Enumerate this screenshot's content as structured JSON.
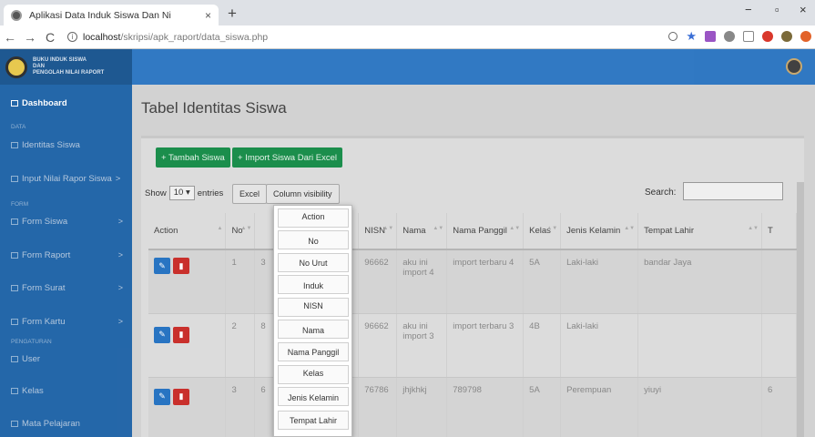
{
  "browser": {
    "tab_title": "Aplikasi Data Induk Siswa Dan Ni",
    "tab_close": "×",
    "new_tab": "+",
    "url_host": "localhost",
    "url_path": "/skripsi/apk_raport/data_siswa.php",
    "back": "←",
    "forward": "→",
    "reload": "C",
    "minimize": "−",
    "maximize": "▫",
    "close": "×"
  },
  "sidebar": {
    "brand": [
      "BUKU INDUK SISWA",
      "DAN",
      "PENGOLAH NILAI RAPORT"
    ],
    "dashboard": "Dashboard",
    "header_data": "DATA",
    "identitas_siswa": "Identitas Siswa",
    "input_nilai": "Input Nilai Rapor Siswa",
    "header_form": "FORM",
    "form_siswa": "Form Siswa",
    "form_raport": "Form Raport",
    "form_surat": "Form Surat",
    "form_kartu": "Form Kartu",
    "header_pengaturan": "PENGATURAN",
    "user": "User",
    "kelas": "Kelas",
    "mata_pelajaran": "Mata Pelajaran",
    "chevron": ">"
  },
  "main": {
    "title": "Tabel Identitas Siswa",
    "btn_tambah": "+ Tambah Siswa",
    "btn_import": "+ Import Siswa Dari Excel",
    "show_label": "Show",
    "show_value": "10",
    "entries_label": "entries",
    "btn_excel": "Excel",
    "btn_colvis": "Column visibility",
    "search_label": "Search:"
  },
  "table": {
    "headers": {
      "action": "Action",
      "no": "No",
      "nisn": "NISN",
      "nama": "Nama",
      "nama_panggil": "Nama Panggil",
      "kelas": "Kelas",
      "jenis_kelamin": "Jenis Kelamin",
      "tempat_lahir": "Tempat Lahir",
      "t": "T"
    },
    "rows": [
      {
        "no": "1",
        "hidden": "3",
        "nisn": "96662",
        "nama": "aku ini import 4",
        "panggil": "import terbaru 4",
        "kelas": "5A",
        "jk": "Laki-laki",
        "tempat": "bandar Jaya",
        "t": ""
      },
      {
        "no": "2",
        "hidden": "8",
        "nisn": "96662",
        "nama": "aku ini import 3",
        "panggil": "import terbaru 3",
        "kelas": "4B",
        "jk": "Laki-laki",
        "tempat": "",
        "t": ""
      },
      {
        "no": "3",
        "hidden": "6",
        "nisn": "76786",
        "nama": "jhjkhkj",
        "panggil": "789798",
        "kelas": "5A",
        "jk": "Perempuan",
        "tempat": "yiuyi",
        "t": "6"
      }
    ]
  },
  "colvis": {
    "items": [
      "Action",
      "No",
      "No Urut",
      "Induk",
      "NISN",
      "Nama",
      "Nama Panggil",
      "Kelas",
      "Jenis Kelamin",
      "Tempat Lahir"
    ]
  }
}
